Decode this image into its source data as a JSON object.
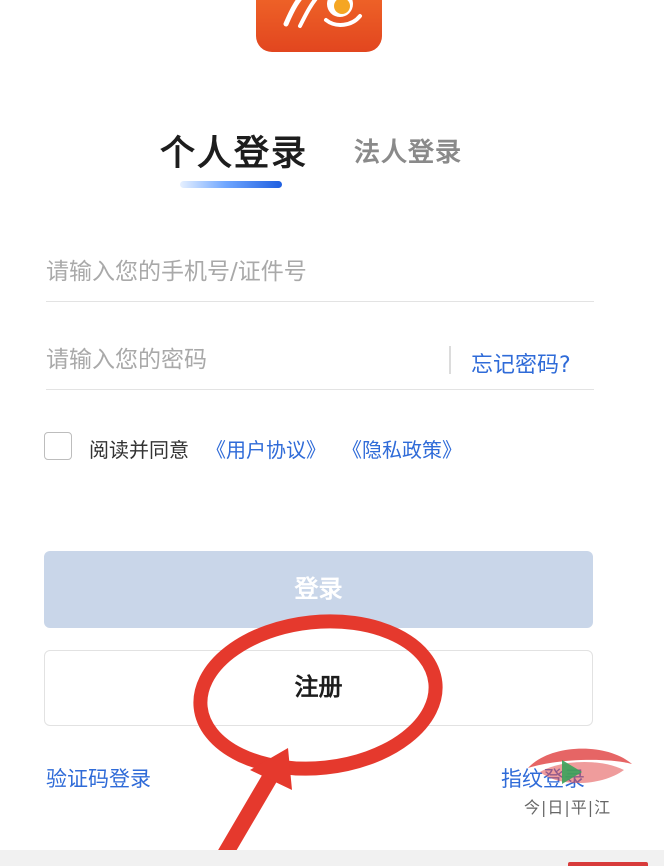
{
  "app": {
    "logo_icon": "app-logo-icon",
    "accent_color": "#e8521f"
  },
  "tabs": [
    {
      "label": "个人登录",
      "active": true
    },
    {
      "label": "法人登录",
      "active": false
    }
  ],
  "form": {
    "phone_placeholder": "请输入您的手机号/证件号",
    "phone_value": "",
    "password_placeholder": "请输入您的密码",
    "password_value": "",
    "forgot_password": "忘记密码?"
  },
  "agreement": {
    "checked": false,
    "text": "阅读并同意",
    "user_agreement": "《用户协议》",
    "privacy_policy": "《隐私政策》"
  },
  "buttons": {
    "login": "登录",
    "register": "注册"
  },
  "alt_logins": {
    "sms": "验证码登录",
    "fingerprint": "指纹登录"
  },
  "watermark": {
    "text": "今|日|平|江"
  },
  "colors": {
    "link": "#2f6bd8",
    "login_disabled": "#c9d6e9",
    "annotation_red": "#e5392d"
  }
}
